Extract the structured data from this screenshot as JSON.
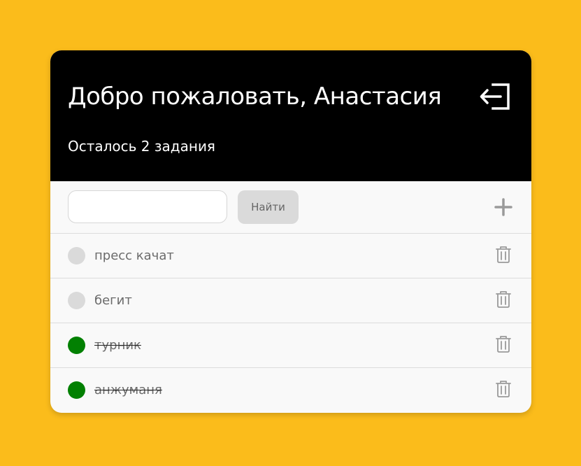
{
  "header": {
    "welcome": "Добро пожаловать, Анастасия",
    "remaining": "Осталось 2 задания",
    "logout_icon": "logout-icon"
  },
  "toolbar": {
    "search_value": "",
    "search_placeholder": "",
    "find_label": "Найти",
    "add_icon": "plus-icon"
  },
  "tasks": [
    {
      "text": "пресс качат",
      "done": false
    },
    {
      "text": "бегит",
      "done": false
    },
    {
      "text": "турник",
      "done": true
    },
    {
      "text": "анжуманя",
      "done": true
    }
  ],
  "colors": {
    "background": "#FBBC1B",
    "header": "#000000",
    "done": "#028002",
    "pending": "#DADADA"
  }
}
